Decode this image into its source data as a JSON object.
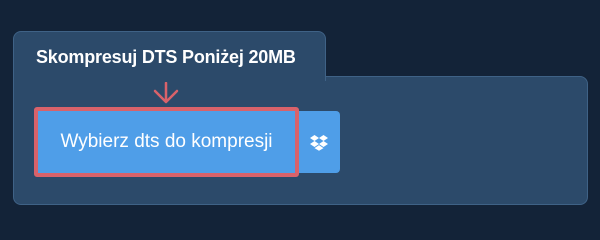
{
  "tab": {
    "title": "Skompresuj DTS Poniżej 20MB"
  },
  "upload": {
    "choose_label": "Wybierz dts do kompresji",
    "dropbox_icon": "dropbox-icon"
  },
  "annotation": {
    "arrow_icon": "arrow-down-icon",
    "highlight_color": "#d9626a"
  },
  "colors": {
    "background": "#132338",
    "panel": "#2c4a6a",
    "button": "#4f9ee8"
  }
}
